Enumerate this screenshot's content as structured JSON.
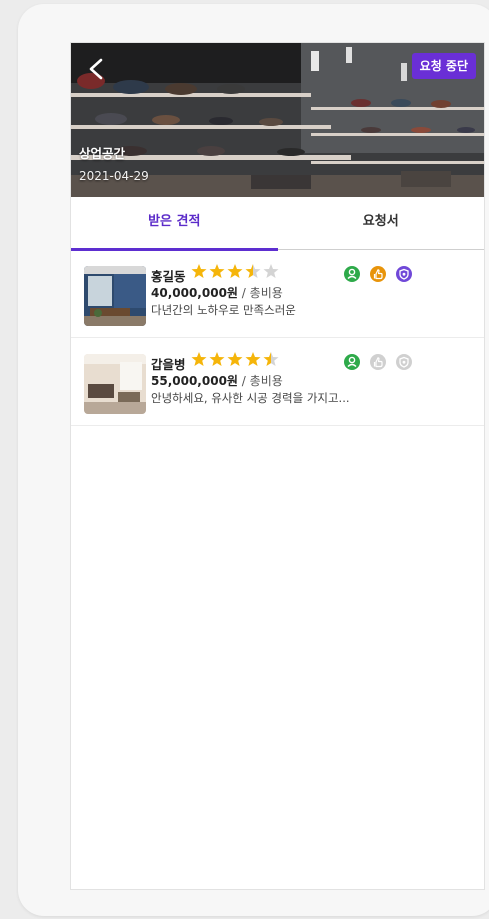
{
  "header": {
    "title": "상업공간",
    "date": "2021-04-29",
    "stop_button": "요청 중단"
  },
  "tabs": [
    {
      "label": "받은 견적",
      "active": true
    },
    {
      "label": "요청서",
      "active": false
    }
  ],
  "quotes": [
    {
      "name": "홍길동",
      "rating": 3.5,
      "price": "40,000,000원",
      "price_unit": "/ 총비용",
      "message": "다년간의 노하우로 만족스러운",
      "badges": [
        {
          "icon": "certified-person-icon",
          "active": true,
          "color": "#2eaa4a"
        },
        {
          "icon": "thumbs-up-icon",
          "active": true,
          "color": "#e8940a"
        },
        {
          "icon": "shield-icon",
          "active": true,
          "color": "#7048d8"
        }
      ]
    },
    {
      "name": "갑을병",
      "rating": 4.5,
      "price": "55,000,000원",
      "price_unit": "/ 총비용",
      "message": "안녕하세요, 유사한 시공 경력을 가지고...",
      "badges": [
        {
          "icon": "certified-person-icon",
          "active": true,
          "color": "#2eaa4a"
        },
        {
          "icon": "thumbs-up-icon",
          "active": false,
          "color": "#d0d0d0"
        },
        {
          "icon": "shield-icon",
          "active": false,
          "color": "#d0d0d0"
        }
      ]
    }
  ],
  "colors": {
    "accent": "#5d2ed0",
    "star_on": "#f5b50a",
    "star_off": "#d4d4d4"
  }
}
